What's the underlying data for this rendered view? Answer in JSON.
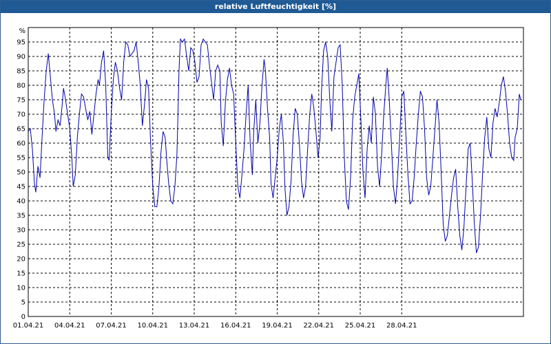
{
  "window": {
    "title": "relative Luftfeuchtigkeit [%]"
  },
  "chart_data": {
    "type": "line",
    "title": "relative Luftfeuchtigkeit [%]",
    "ylabel": "%",
    "xlabel": "",
    "ylim": [
      0,
      100
    ],
    "yticks": [
      0,
      5,
      10,
      15,
      20,
      25,
      30,
      35,
      40,
      45,
      50,
      55,
      60,
      65,
      70,
      75,
      80,
      85,
      90,
      95
    ],
    "xticks": [
      "01.04.21",
      "04.04.21",
      "07.04.21",
      "10.04.21",
      "13.04.21",
      "16.04.21",
      "19.04.21",
      "22.04.21",
      "25.04.21",
      "28.04.21"
    ],
    "x_range_days": [
      0,
      30
    ],
    "grid": true,
    "line_color": "#0000aa",
    "series": [
      {
        "points": [
          [
            0.0,
            64
          ],
          [
            0.15,
            65
          ],
          [
            0.3,
            58
          ],
          [
            0.45,
            46
          ],
          [
            0.55,
            43
          ],
          [
            0.7,
            52
          ],
          [
            0.85,
            48
          ],
          [
            1.0,
            62
          ],
          [
            1.15,
            75
          ],
          [
            1.3,
            85
          ],
          [
            1.45,
            91
          ],
          [
            1.6,
            83
          ],
          [
            1.75,
            75
          ],
          [
            1.9,
            70
          ],
          [
            2.0,
            64
          ],
          [
            2.15,
            68
          ],
          [
            2.3,
            66
          ],
          [
            2.45,
            73
          ],
          [
            2.55,
            79
          ],
          [
            2.7,
            75
          ],
          [
            2.85,
            70
          ],
          [
            3.0,
            65
          ],
          [
            3.15,
            55
          ],
          [
            3.25,
            45
          ],
          [
            3.4,
            49
          ],
          [
            3.55,
            62
          ],
          [
            3.7,
            70
          ],
          [
            3.85,
            77
          ],
          [
            4.0,
            76
          ],
          [
            4.15,
            72
          ],
          [
            4.3,
            68
          ],
          [
            4.45,
            71
          ],
          [
            4.6,
            63
          ],
          [
            4.75,
            70
          ],
          [
            4.9,
            77
          ],
          [
            5.05,
            82
          ],
          [
            5.15,
            80
          ],
          [
            5.3,
            88
          ],
          [
            5.45,
            92
          ],
          [
            5.6,
            80
          ],
          [
            5.75,
            55
          ],
          [
            5.85,
            54
          ],
          [
            6.0,
            70
          ],
          [
            6.15,
            82
          ],
          [
            6.3,
            88
          ],
          [
            6.45,
            85
          ],
          [
            6.6,
            79
          ],
          [
            6.75,
            75
          ],
          [
            6.9,
            88
          ],
          [
            7.05,
            95
          ],
          [
            7.2,
            94
          ],
          [
            7.35,
            90
          ],
          [
            7.5,
            91
          ],
          [
            7.65,
            92
          ],
          [
            7.8,
            95
          ],
          [
            7.95,
            88
          ],
          [
            8.1,
            80
          ],
          [
            8.25,
            66
          ],
          [
            8.4,
            73
          ],
          [
            8.55,
            82
          ],
          [
            8.7,
            79
          ],
          [
            8.85,
            60
          ],
          [
            9.0,
            45
          ],
          [
            9.15,
            38
          ],
          [
            9.3,
            38
          ],
          [
            9.45,
            45
          ],
          [
            9.6,
            57
          ],
          [
            9.75,
            64
          ],
          [
            9.9,
            62
          ],
          [
            10.0,
            55
          ],
          [
            10.15,
            46
          ],
          [
            10.3,
            40
          ],
          [
            10.45,
            39
          ],
          [
            10.6,
            45
          ],
          [
            10.75,
            56
          ],
          [
            10.9,
            85
          ],
          [
            11.0,
            96
          ],
          [
            11.15,
            95
          ],
          [
            11.3,
            96
          ],
          [
            11.45,
            90
          ],
          [
            11.6,
            85
          ],
          [
            11.75,
            93
          ],
          [
            11.9,
            92
          ],
          [
            12.05,
            88
          ],
          [
            12.2,
            81
          ],
          [
            12.35,
            83
          ],
          [
            12.5,
            94
          ],
          [
            12.65,
            96
          ],
          [
            12.8,
            95
          ],
          [
            12.95,
            94
          ],
          [
            13.1,
            87
          ],
          [
            13.25,
            81
          ],
          [
            13.4,
            75
          ],
          [
            13.55,
            85
          ],
          [
            13.7,
            87
          ],
          [
            13.85,
            85
          ],
          [
            13.95,
            67
          ],
          [
            14.1,
            59
          ],
          [
            14.25,
            74
          ],
          [
            14.4,
            82
          ],
          [
            14.55,
            86
          ],
          [
            14.7,
            80
          ],
          [
            14.85,
            77
          ],
          [
            15.0,
            60
          ],
          [
            15.15,
            45
          ],
          [
            15.3,
            41
          ],
          [
            15.45,
            49
          ],
          [
            15.6,
            58
          ],
          [
            15.75,
            70
          ],
          [
            15.9,
            80
          ],
          [
            16.05,
            60
          ],
          [
            16.2,
            49
          ],
          [
            16.3,
            64
          ],
          [
            16.45,
            75
          ],
          [
            16.6,
            60
          ],
          [
            16.75,
            67
          ],
          [
            16.9,
            80
          ],
          [
            17.05,
            89
          ],
          [
            17.15,
            85
          ],
          [
            17.3,
            72
          ],
          [
            17.45,
            62
          ],
          [
            17.55,
            46
          ],
          [
            17.7,
            41
          ],
          [
            17.85,
            48
          ],
          [
            18.0,
            55
          ],
          [
            18.15,
            65
          ],
          [
            18.3,
            70
          ],
          [
            18.45,
            60
          ],
          [
            18.55,
            45
          ],
          [
            18.7,
            35
          ],
          [
            18.85,
            38
          ],
          [
            19.0,
            47
          ],
          [
            19.15,
            63
          ],
          [
            19.3,
            72
          ],
          [
            19.45,
            70
          ],
          [
            19.6,
            60
          ],
          [
            19.75,
            47
          ],
          [
            19.9,
            41
          ],
          [
            20.05,
            45
          ],
          [
            20.2,
            58
          ],
          [
            20.35,
            70
          ],
          [
            20.5,
            77
          ],
          [
            20.65,
            72
          ],
          [
            20.8,
            64
          ],
          [
            20.95,
            55
          ],
          [
            21.1,
            62
          ],
          [
            21.2,
            78
          ],
          [
            21.35,
            92
          ],
          [
            21.5,
            95
          ],
          [
            21.65,
            90
          ],
          [
            21.8,
            75
          ],
          [
            21.95,
            64
          ],
          [
            22.1,
            83
          ],
          [
            22.25,
            88
          ],
          [
            22.4,
            93
          ],
          [
            22.55,
            94
          ],
          [
            22.7,
            80
          ],
          [
            22.85,
            55
          ],
          [
            23.0,
            40
          ],
          [
            23.15,
            37
          ],
          [
            23.3,
            48
          ],
          [
            23.45,
            68
          ],
          [
            23.6,
            76
          ],
          [
            23.75,
            80
          ],
          [
            23.9,
            84
          ],
          [
            24.05,
            68
          ],
          [
            24.2,
            50
          ],
          [
            24.35,
            41
          ],
          [
            24.5,
            58
          ],
          [
            24.65,
            66
          ],
          [
            24.8,
            60
          ],
          [
            24.95,
            76
          ],
          [
            25.1,
            70
          ],
          [
            25.25,
            52
          ],
          [
            25.4,
            45
          ],
          [
            25.55,
            56
          ],
          [
            25.7,
            70
          ],
          [
            25.85,
            80
          ],
          [
            25.95,
            86
          ],
          [
            26.1,
            75
          ],
          [
            26.25,
            60
          ],
          [
            26.4,
            45
          ],
          [
            26.55,
            39
          ],
          [
            26.7,
            48
          ],
          [
            26.85,
            62
          ],
          [
            27.0,
            76
          ],
          [
            27.15,
            78
          ],
          [
            27.3,
            63
          ],
          [
            27.45,
            49
          ],
          [
            27.6,
            39
          ],
          [
            27.75,
            40
          ],
          [
            27.9,
            48
          ],
          [
            28.05,
            60
          ],
          [
            28.2,
            70
          ],
          [
            28.35,
            78
          ],
          [
            28.5,
            76
          ],
          [
            28.65,
            65
          ],
          [
            28.8,
            48
          ],
          [
            28.95,
            42
          ],
          [
            29.1,
            45
          ],
          [
            29.25,
            55
          ],
          [
            29.4,
            65
          ],
          [
            29.55,
            75
          ],
          [
            29.7,
            67
          ],
          [
            29.85,
            50
          ],
          [
            30.0,
            32
          ],
          [
            30.15,
            26
          ],
          [
            30.3,
            28
          ],
          [
            30.45,
            35
          ],
          [
            30.6,
            42
          ],
          [
            30.75,
            48
          ],
          [
            30.9,
            51
          ],
          [
            31.05,
            38
          ],
          [
            31.2,
            28
          ],
          [
            31.35,
            23
          ],
          [
            31.5,
            31
          ],
          [
            31.65,
            45
          ],
          [
            31.8,
            58
          ],
          [
            31.95,
            60
          ],
          [
            32.1,
            47
          ],
          [
            32.25,
            32
          ],
          [
            32.4,
            22
          ],
          [
            32.55,
            24
          ],
          [
            32.7,
            35
          ],
          [
            32.85,
            50
          ],
          [
            33.0,
            62
          ],
          [
            33.15,
            69
          ],
          [
            33.3,
            58
          ],
          [
            33.45,
            55
          ],
          [
            33.6,
            67
          ],
          [
            33.75,
            72
          ],
          [
            33.9,
            69
          ],
          [
            34.05,
            74
          ],
          [
            34.2,
            80
          ],
          [
            34.35,
            83
          ],
          [
            34.5,
            78
          ],
          [
            34.65,
            70
          ],
          [
            34.8,
            60
          ],
          [
            34.95,
            55
          ],
          [
            35.1,
            54
          ],
          [
            35.2,
            62
          ],
          [
            35.35,
            65
          ],
          [
            35.5,
            77
          ],
          [
            35.6,
            75
          ]
        ]
      }
    ]
  }
}
